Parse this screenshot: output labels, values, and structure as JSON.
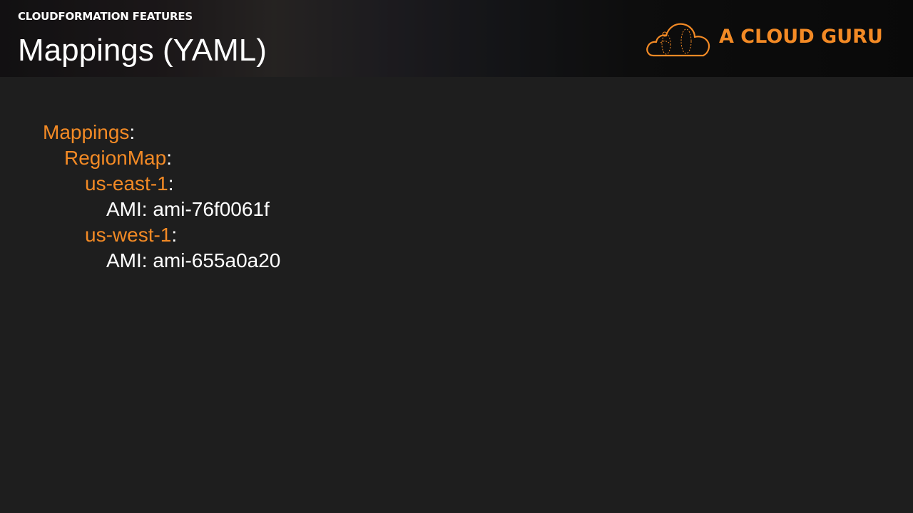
{
  "header": {
    "kicker": "CLOUDFORMATION FEATURES",
    "title": "Mappings (YAML)"
  },
  "logo": {
    "icon": "cloud-icon",
    "text": "A CLOUD GURU",
    "color": "#f38a25"
  },
  "code": {
    "mappings_key": "Mappings",
    "regionmap_key": "RegionMap",
    "regions": [
      {
        "key": "us-east-1",
        "ami_label": "AMI: ami-76f0061f"
      },
      {
        "key": "us-west-1",
        "ami_label": "AMI: ami-655a0a20"
      }
    ],
    "colon": ":"
  },
  "colors": {
    "accent": "#f38a25",
    "background": "#1e1e1e",
    "text": "#ffffff"
  }
}
